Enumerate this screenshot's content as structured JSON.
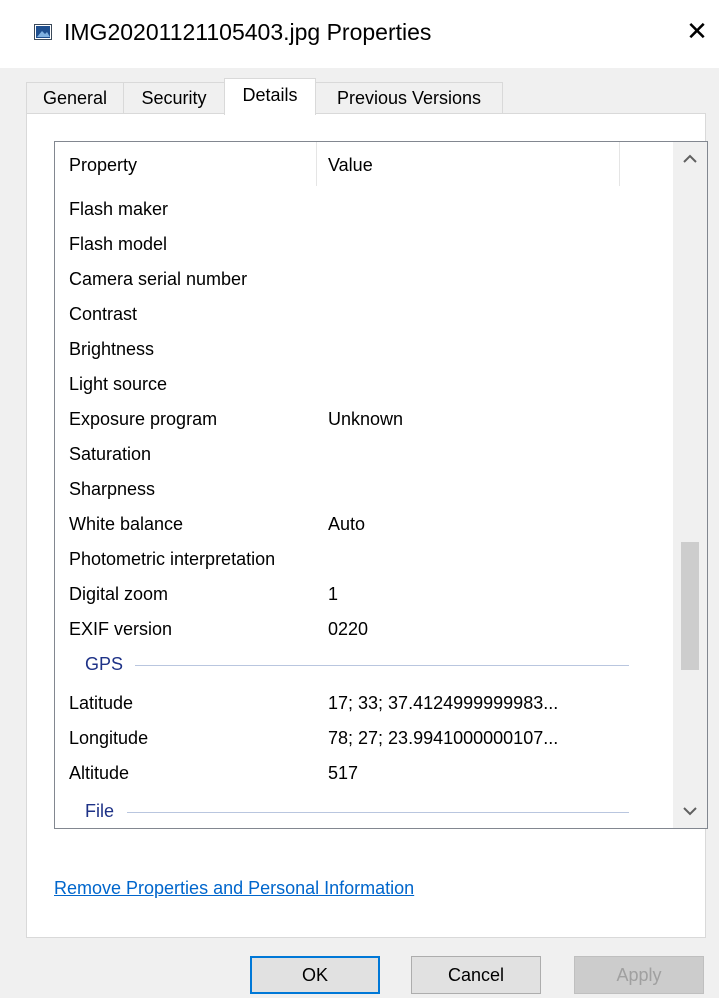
{
  "window": {
    "title": "IMG20201121105403.jpg Properties",
    "close_glyph": "✕"
  },
  "tabs": [
    {
      "label": "General"
    },
    {
      "label": "Security"
    },
    {
      "label": "Details",
      "active": true
    },
    {
      "label": "Previous Versions"
    }
  ],
  "details": {
    "header": {
      "property": "Property",
      "value": "Value"
    },
    "rows": [
      {
        "property": "Flash maker",
        "value": ""
      },
      {
        "property": "Flash model",
        "value": ""
      },
      {
        "property": "Camera serial number",
        "value": ""
      },
      {
        "property": "Contrast",
        "value": ""
      },
      {
        "property": "Brightness",
        "value": ""
      },
      {
        "property": "Light source",
        "value": ""
      },
      {
        "property": "Exposure program",
        "value": "Unknown"
      },
      {
        "property": "Saturation",
        "value": ""
      },
      {
        "property": "Sharpness",
        "value": ""
      },
      {
        "property": "White balance",
        "value": "Auto"
      },
      {
        "property": "Photometric interpretation",
        "value": ""
      },
      {
        "property": "Digital zoom",
        "value": "1"
      },
      {
        "property": "EXIF version",
        "value": "0220"
      }
    ],
    "gps_group": "GPS",
    "gps_rows": [
      {
        "property": "Latitude",
        "value": "17; 33; 37.4124999999983..."
      },
      {
        "property": "Longitude",
        "value": "78; 27; 23.9941000000107..."
      },
      {
        "property": "Altitude",
        "value": "517"
      }
    ],
    "file_group": "File"
  },
  "scrollbar": {
    "up_glyph": "⌃",
    "down_glyph": "⌄"
  },
  "link": {
    "label": "Remove Properties and Personal Information"
  },
  "buttons": {
    "ok": "OK",
    "cancel": "Cancel",
    "apply": "Apply"
  },
  "colors": {
    "link": "#0066cc",
    "group_header": "#1e3287",
    "default_button_border": "#0078d7"
  }
}
